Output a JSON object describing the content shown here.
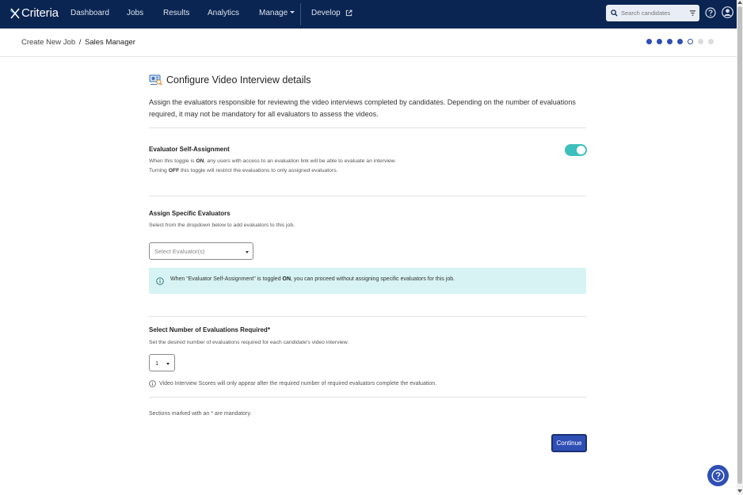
{
  "brand": {
    "name": "Criteria",
    "accent": "#2f4fb5",
    "nav_bg": "#0b2552",
    "toggle_color": "#3dbfbd"
  },
  "nav": {
    "items": [
      {
        "label": "Dashboard"
      },
      {
        "label": "Jobs"
      },
      {
        "label": "Results"
      },
      {
        "label": "Analytics"
      },
      {
        "label": "Manage"
      },
      {
        "label": "Develop"
      }
    ],
    "search_placeholder": "Search candidates"
  },
  "breadcrumb": {
    "parent": "Create New Job",
    "separator": "/",
    "current": "Sales Manager"
  },
  "steps": {
    "total": 7,
    "completed": 4,
    "current": 5
  },
  "page": {
    "title": "Configure Video Interview details",
    "intro": "Assign the evaluators responsible for reviewing the video interviews completed by candidates. Depending on the number of evaluations required, it may not be mandatory for all evaluators to assess the videos."
  },
  "self_assignment": {
    "title": "Evaluator Self-Assignment",
    "line1_pre": "When this toggle is ",
    "line1_bold": "ON",
    "line1_post": ", any users with access to an evaluation link will be able to evaluate an interview.",
    "line2_pre": "Turning ",
    "line2_bold": "OFF",
    "line2_post": " this toggle will restrict the evaluations to only assigned evaluators.",
    "toggle_on": true
  },
  "evaluators": {
    "title": "Assign Specific Evaluators",
    "desc": "Select from the dropdown below to add evaluators to this job.",
    "placeholder": "Select Evaluator(s)",
    "info_pre": "When \"Evaluator Self-Assignment\" is toggled ",
    "info_bold": "ON",
    "info_post": ", you can proceed without assigning specific evaluators for this job."
  },
  "evaluations": {
    "title": "Select Number of Evaluations Required*",
    "desc": "Set the desired number of evaluations required for each candidate's video interview.",
    "selected_value": "1",
    "note": "Video Interview Scores will only appear after the required number of required evaluators complete the evaluation."
  },
  "footer": {
    "mandatory_note": "Sections marked with an * are mandatory.",
    "continue_label": "Continue"
  },
  "icons": {
    "logo": "criteria-logo-icon",
    "external": "external-link-icon",
    "search": "search-icon",
    "filter": "filter-icon",
    "help": "help-icon",
    "user": "user-icon",
    "title": "video-interview-icon",
    "info": "info-icon"
  }
}
